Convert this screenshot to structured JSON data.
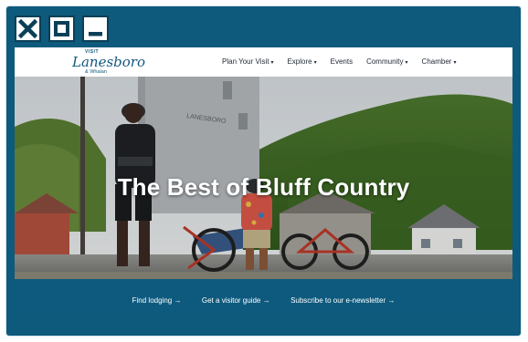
{
  "window_controls": {
    "close_icon": "close-icon",
    "maximize_icon": "maximize-icon",
    "minimize_icon": "minimize-icon"
  },
  "site": {
    "logo": {
      "visit": "VISIT",
      "name": "Lanesboro",
      "sub": "& Whalan"
    },
    "nav": [
      {
        "label": "Plan Your Visit",
        "caret": "▾"
      },
      {
        "label": "Explore",
        "caret": "▾"
      },
      {
        "label": "Events",
        "caret": ""
      },
      {
        "label": "Community",
        "caret": "▾"
      },
      {
        "label": "Chamber",
        "caret": "▾"
      }
    ],
    "hero": {
      "headline": "The Best of Bluff Country"
    },
    "footer_links": [
      "Find lodging →",
      "Get a visitor guide →",
      "Subscribe to our e-newsletter →"
    ]
  },
  "colors": {
    "frame": "#0d5a7c",
    "footer": "#0e5a7e",
    "logo": "#13587c"
  }
}
